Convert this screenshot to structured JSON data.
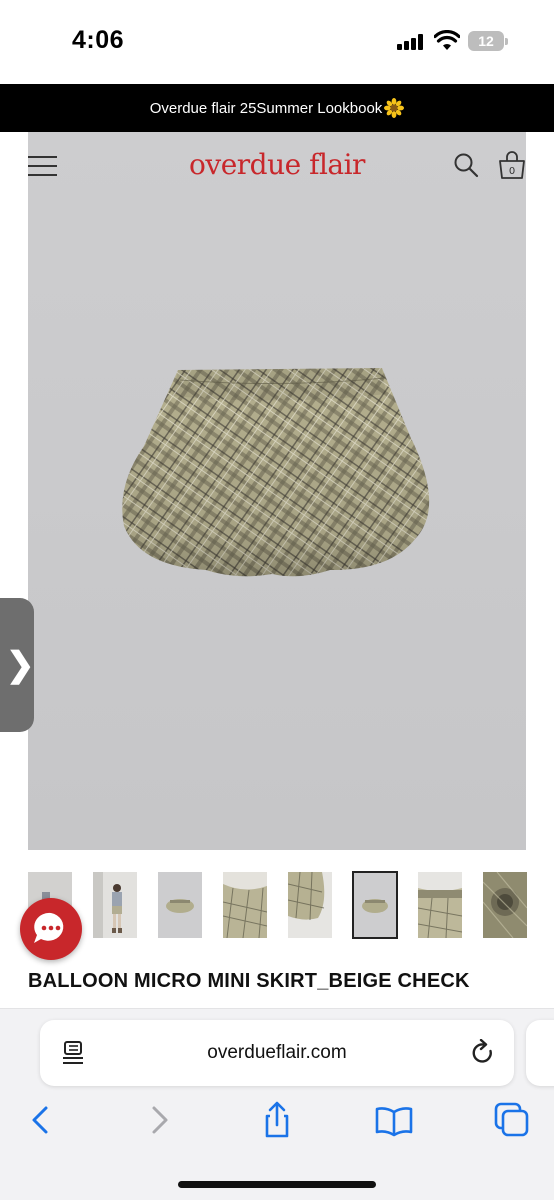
{
  "status_bar": {
    "time": "4:06",
    "battery_level": "12"
  },
  "banner": {
    "text": "Overdue flair 25Summer Lookbook",
    "emoji_icon": "sunflower-icon"
  },
  "header": {
    "logo": "overdue flair",
    "logo_color": "#c8272b",
    "bag_count": "0"
  },
  "product": {
    "title": "BALLOON MICRO MINI SKIRT_BEIGE CHECK",
    "thumbnails": [
      {
        "name": "thumb-1",
        "selected": false
      },
      {
        "name": "thumb-2",
        "selected": false
      },
      {
        "name": "thumb-3",
        "selected": false
      },
      {
        "name": "thumb-4",
        "selected": false
      },
      {
        "name": "thumb-5",
        "selected": false
      },
      {
        "name": "thumb-6",
        "selected": true
      },
      {
        "name": "thumb-7",
        "selected": false
      },
      {
        "name": "thumb-8",
        "selected": false
      }
    ]
  },
  "side_tab": {
    "arrow": "❯"
  },
  "browser": {
    "url": "overdueflair.com",
    "accent": "#1a73e8"
  }
}
